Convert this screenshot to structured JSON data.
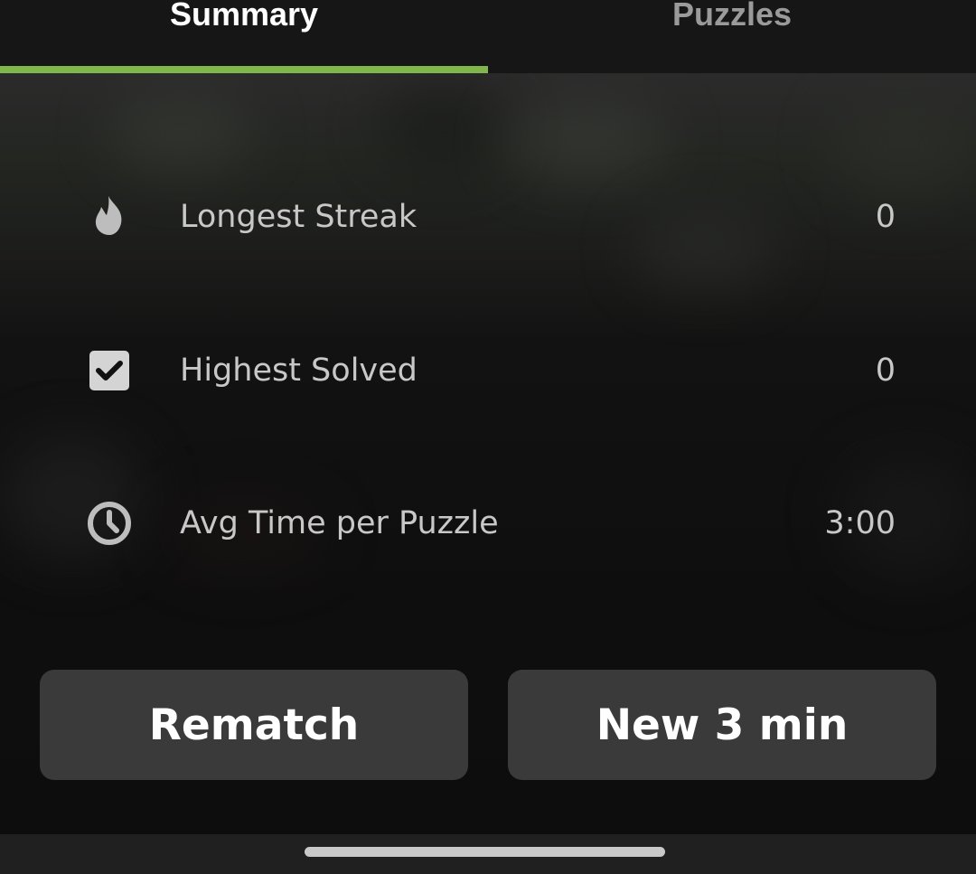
{
  "tabs": [
    {
      "label": "Summary",
      "selected": true
    },
    {
      "label": "Puzzles",
      "selected": false
    }
  ],
  "colors": {
    "accent": "#81b64c",
    "button_bg": "#3a3a3a",
    "text_muted": "#c8c8c8"
  },
  "stats": [
    {
      "icon": "flame-icon",
      "label": "Longest Streak",
      "value": "0"
    },
    {
      "icon": "checkbox-icon",
      "label": "Highest Solved",
      "value": "0"
    },
    {
      "icon": "clock-icon",
      "label": "Avg Time per Puzzle",
      "value": "3:00"
    }
  ],
  "actions": {
    "rematch_label": "Rematch",
    "new_game_label": "New 3 min"
  }
}
